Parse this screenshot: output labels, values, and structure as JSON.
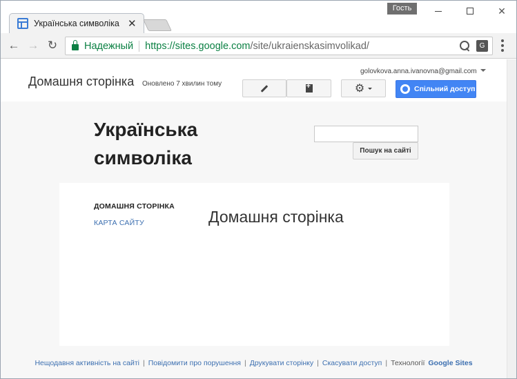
{
  "browser": {
    "guest_badge": "Гость",
    "tab_title": "Українська символіка",
    "tab_close": "✕",
    "secure_label": "Надежный",
    "url_host": "https://sites.google.com",
    "url_path": "/site/ukraienskasimvolikad/",
    "translate_icon_glyph": "G"
  },
  "sites_header": {
    "page_heading": "Домашня сторінка",
    "updated": "Оновлено 7 хвилин тому",
    "account": "golovkova.anna.ivanovna@gmail.com",
    "share_label": "Спільний доступ",
    "gear_glyph": "⚙"
  },
  "site": {
    "title": "Українська символіка",
    "search_button": "Пошук на сайті",
    "search_value": "",
    "nav": {
      "home": "ДОМАШНЯ СТОРІНКА",
      "sitemap": "КАРТА САЙТУ"
    },
    "content_title": "Домашня сторінка"
  },
  "footer": {
    "recent_activity": "Нещодавня активність на сайті",
    "report_abuse": "Повідомити про порушення",
    "print_page": "Друкувати сторінку",
    "revoke_access": "Скасувати доступ",
    "powered_by": "Технології",
    "brand": "Google Sites",
    "separator": "|"
  },
  "colors": {
    "accent": "#4285f4",
    "secure_green": "#0b8043",
    "link": "#3c6fb0"
  }
}
